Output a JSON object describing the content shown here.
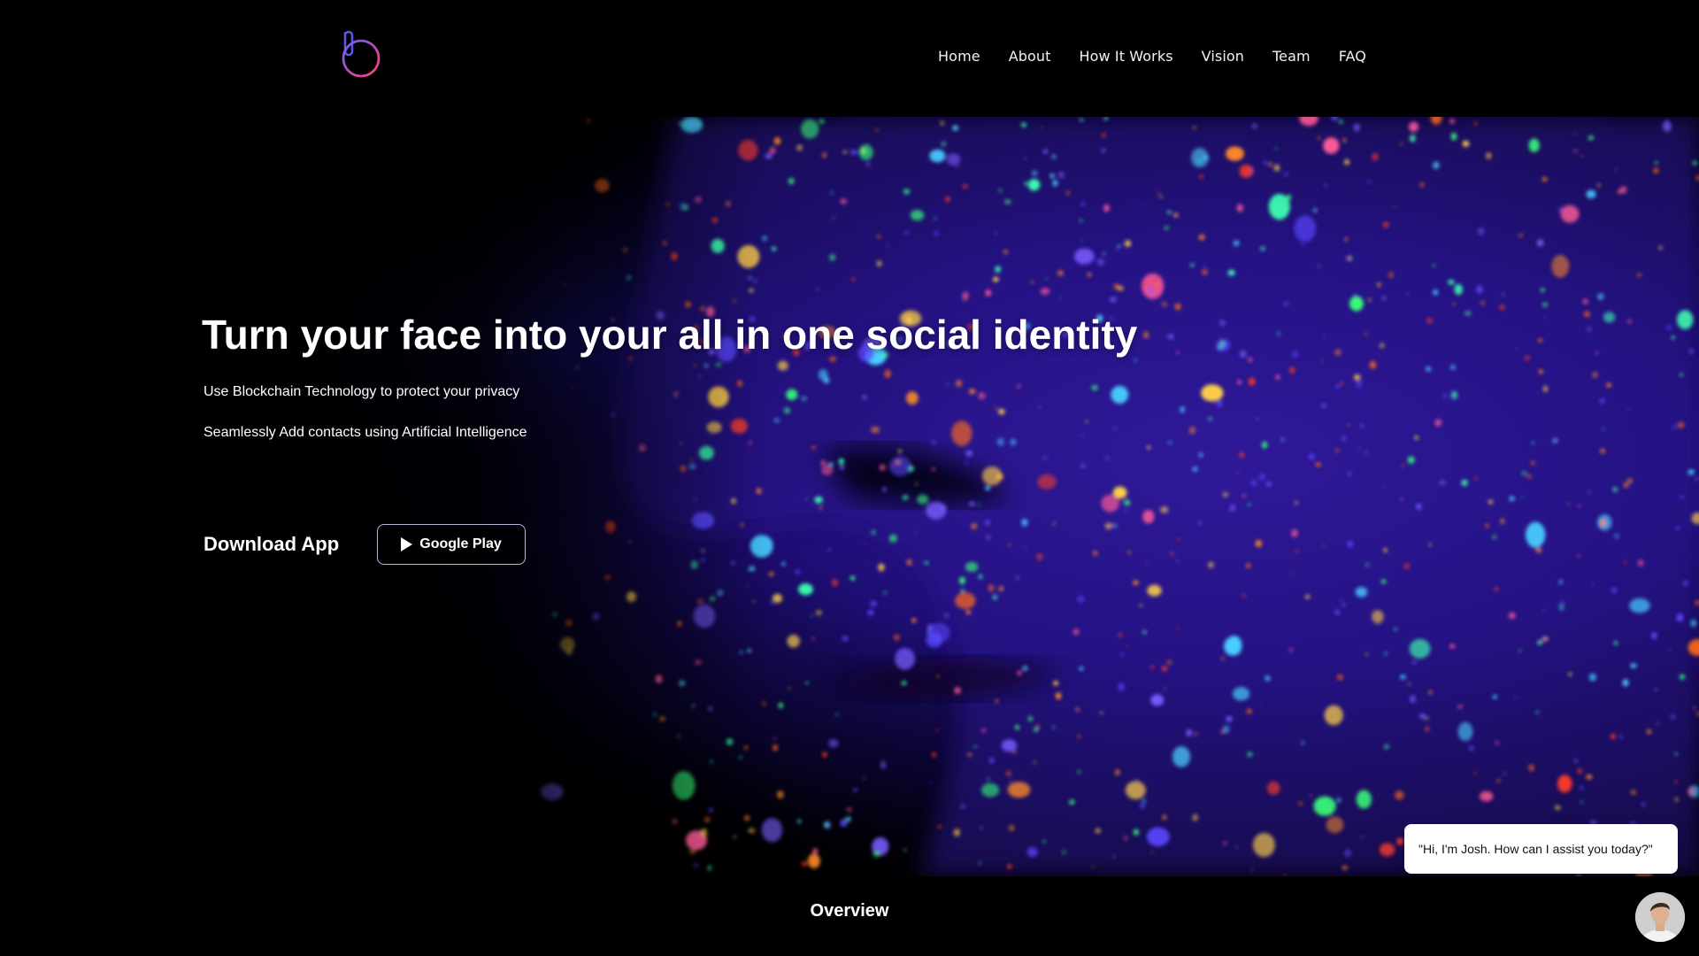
{
  "header": {
    "logo_icon": "brand-logo-icon",
    "nav": [
      {
        "label": "Home"
      },
      {
        "label": "About"
      },
      {
        "label": "How It Works"
      },
      {
        "label": "Vision"
      },
      {
        "label": "Team"
      },
      {
        "label": "FAQ"
      }
    ]
  },
  "hero": {
    "title": "Turn your face into your all in one social identity",
    "line1": "Use Blockchain Technology to protect your privacy",
    "line2": "Seamlessly Add contacts using Artificial Intelligence",
    "download_label": "Download App",
    "google_play_label": "Google Play",
    "play_icon": "play-icon"
  },
  "overview": {
    "heading": "Overview"
  },
  "chat": {
    "message": "\"Hi, I'm Josh. How can I assist you today?\"",
    "avatar_icon": "assistant-avatar"
  },
  "colors": {
    "background": "#000000",
    "logo_pink": "#e0407a",
    "logo_blue": "#5a58e8",
    "splash_orange": "#ff6a1a",
    "splash_green": "#3dffb0",
    "splash_blue": "#3a2cff"
  }
}
